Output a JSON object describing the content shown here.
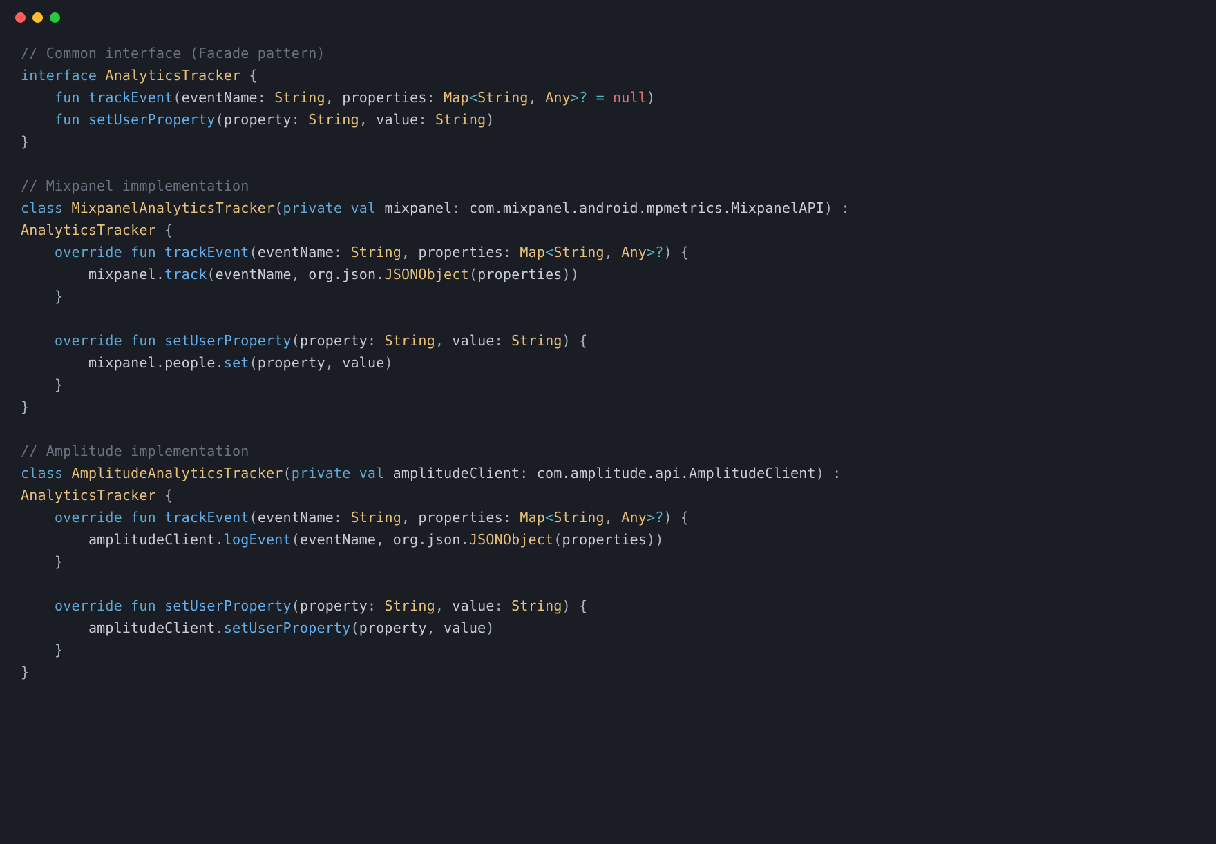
{
  "colors": {
    "bg": "#1a1d23",
    "comment": "#6b7280",
    "keyword": "#5fa8d3",
    "type": "#e6c07b",
    "ident": "#61afef",
    "param": "#c2a3e0",
    "op": "#56b6c2",
    "punct": "#abb2bf",
    "null_kw": "#e06c75"
  },
  "code": {
    "comment1": "// Common interface (Facade pattern)",
    "kw_interface": "interface",
    "name_AnalyticsTracker": "AnalyticsTracker",
    "lbrace": "{",
    "rbrace": "}",
    "kw_fun": "fun",
    "fn_trackEvent": "trackEvent",
    "lparen": "(",
    "rparen": ")",
    "p_eventName": "eventName",
    "colon": ":",
    "t_String": "String",
    "comma": ",",
    "p_properties": "properties",
    "t_Map": "Map",
    "lt": "<",
    "gt": ">",
    "t_Any": "Any",
    "qmark": "?",
    "eq": "=",
    "kw_null": "null",
    "fn_setUserProperty": "setUserProperty",
    "p_property": "property",
    "p_value": "value",
    "comment2": "// Mixpanel immplementation",
    "kw_class": "class",
    "name_MixpanelAnalyticsTracker": "MixpanelAnalyticsTracker",
    "kw_private": "private",
    "kw_val": "val",
    "p_mixpanel": "mixpanel",
    "t_mixpanelAPI": "com.mixpanel.android.mpmetrics.MixpanelAPI",
    "coloncolon_sep": " : ",
    "kw_override": "override",
    "id_mixpanel": "mixpanel",
    "dot": ".",
    "fn_track": "track",
    "ns_org": "org",
    "ns_json": "json",
    "cls_JSONObject": "JSONObject",
    "id_people": "people",
    "fn_set": "set",
    "comment3": "// Amplitude implementation",
    "name_AmplitudeAnalyticsTracker": "AmplitudeAnalyticsTracker",
    "p_amplitudeClient": "amplitudeClient",
    "t_AmplitudeClient": "com.amplitude.api.AmplitudeClient",
    "id_amplitudeClient": "amplitudeClient",
    "fn_logEvent": "logEvent",
    "fn_setUserProperty_call": "setUserProperty"
  }
}
